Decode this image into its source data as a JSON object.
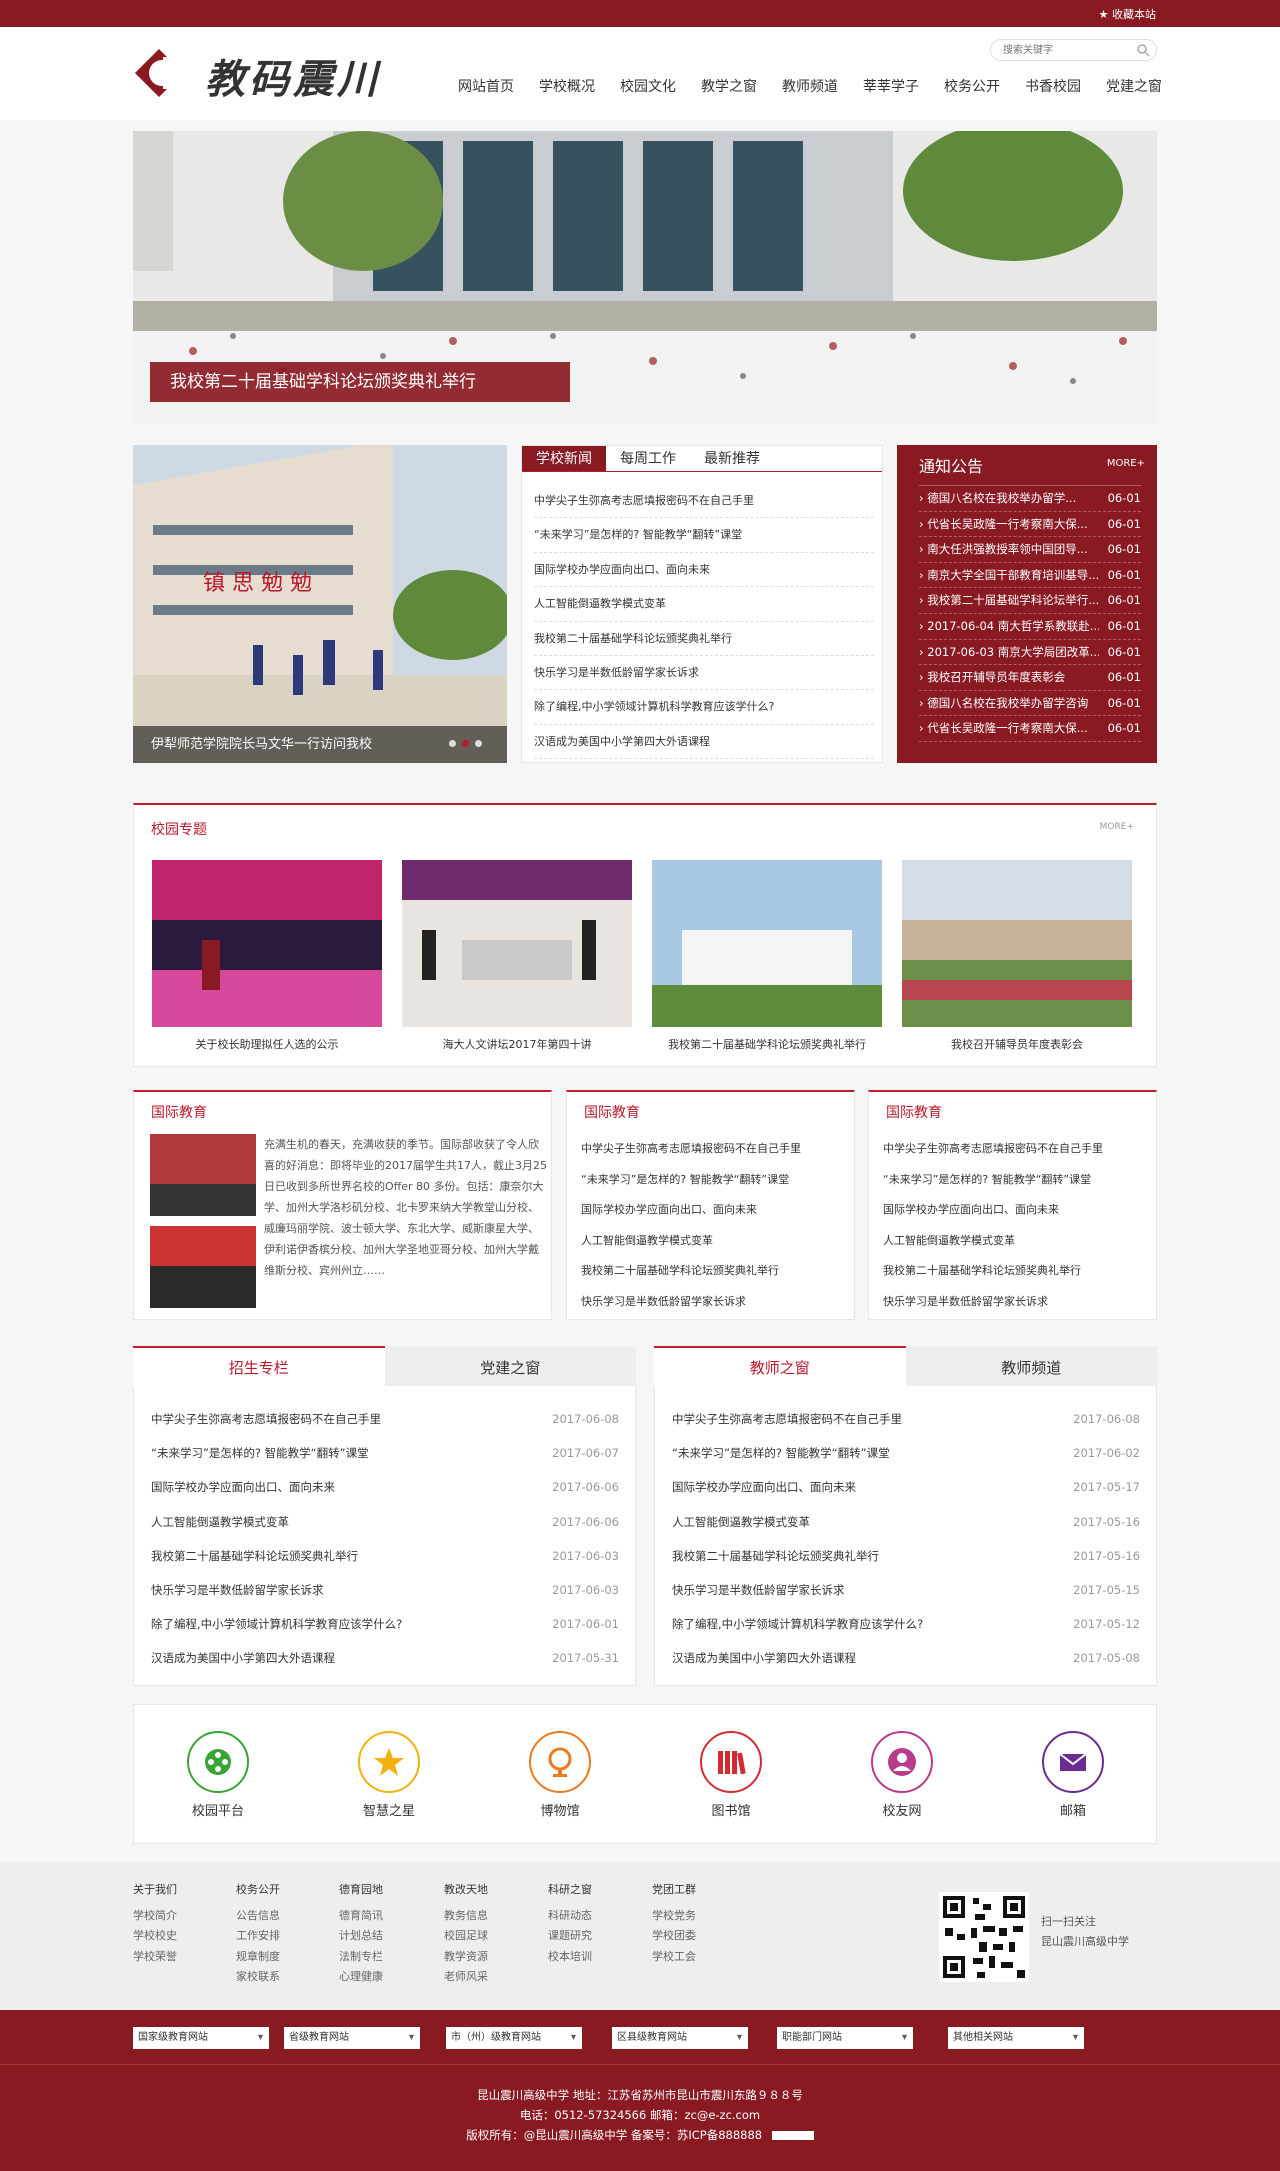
{
  "topbar": {
    "favorite": "收藏本站"
  },
  "header": {
    "logo_text": "教码震川",
    "search_placeholder": "搜索关键字"
  },
  "nav": [
    "网站首页",
    "学校概况",
    "校园文化",
    "教学之窗",
    "教师频道",
    "莘莘学子",
    "校务公开",
    "书香校园",
    "党建之窗"
  ],
  "banner": {
    "caption": "我校第二十届基础学科论坛颁奖典礼举行"
  },
  "slide": {
    "caption": "伊犁师范学院院长马文华一行访问我校"
  },
  "news": {
    "tabs": [
      "学校新闻",
      "每周工作",
      "最新推荐"
    ],
    "items": [
      "中学尖子生弥高考志愿填报密码不在自己手里",
      "“未来学习”是怎样的? 智能教学“翻转”课堂",
      "国际学校办学应面向出口、面向未来",
      "人工智能倒逼教学模式变革",
      "我校第二十届基础学科论坛颁奖典礼举行",
      "快乐学习是半数低龄留学家长诉求",
      "除了编程,中小学领域计算机科学教育应该学什么?",
      "汉语成为美国中小学第四大外语课程"
    ]
  },
  "notice": {
    "title": "通知公告",
    "more": "MORE+",
    "items": [
      {
        "t": "德国八名校在我校举办留学...",
        "d": "06-01"
      },
      {
        "t": "代省长吴政隆一行考察南大保...",
        "d": "06-01"
      },
      {
        "t": "南大任洪强教授率领中国团导...",
        "d": "06-01"
      },
      {
        "t": "南京大学全国干部教育培训基导...",
        "d": "06-01"
      },
      {
        "t": "我校第二十届基础学科论坛举行...",
        "d": "06-01"
      },
      {
        "t": "2017-06-04 南大哲学系教联赴...",
        "d": "06-01"
      },
      {
        "t": "2017-06-03 南京大学局团改革...",
        "d": "06-01"
      },
      {
        "t": "我校召开辅导员年度表彰会",
        "d": "06-01"
      },
      {
        "t": "德国八名校在我校举办留学咨询",
        "d": "06-01"
      },
      {
        "t": "代省长吴政隆一行考察南大保...",
        "d": "06-01"
      }
    ]
  },
  "topics": {
    "title": "校园专题",
    "more": "MORE+",
    "items": [
      "关于校长助理拟任人选的公示",
      "海大人文讲坛2017年第四十讲",
      "我校第二十届基础学科论坛颁奖典礼举行",
      "我校召开辅导员年度表彰会"
    ]
  },
  "intl1": {
    "title": "国际教育",
    "text": "充满生机的春天，充满收获的季节。国际部收获了令人欣喜的好消息：即将毕业的2017届学生共17人，截止3月25日已收到多所世界名校的Offer 80 多份。包括：康奈尔大学、加州大学洛杉矶分校、北卡罗来纳大学教堂山分校、威廉玛丽学院、波士顿大学、东北大学、威斯康星大学、伊利诺伊香槟分校、加州大学圣地亚哥分校、加州大学戴维斯分校、宾州州立……"
  },
  "intl2": {
    "title": "国际教育",
    "items": [
      "中学尖子生弥高考志愿填报密码不在自己手里",
      "“未来学习”是怎样的? 智能教学“翻转”课堂",
      "国际学校办学应面向出口、面向未来",
      "人工智能倒逼教学模式变革",
      "我校第二十届基础学科论坛颁奖典礼举行",
      "快乐学习是半数低龄留学家长诉求"
    ]
  },
  "intl3": {
    "title": "国际教育",
    "items": [
      "中学尖子生弥高考志愿填报密码不在自己手里",
      "“未来学习”是怎样的? 智能教学“翻转”课堂",
      "国际学校办学应面向出口、面向未来",
      "人工智能倒逼教学模式变革",
      "我校第二十届基础学科论坛颁奖典礼举行",
      "快乐学习是半数低龄留学家长诉求"
    ]
  },
  "tab_left": {
    "tabs": [
      "招生专栏",
      "党建之窗"
    ],
    "items": [
      {
        "t": "中学尖子生弥高考志愿填报密码不在自己手里",
        "d": "2017-06-08"
      },
      {
        "t": "“未来学习”是怎样的? 智能教学“翻转”课堂",
        "d": "2017-06-07"
      },
      {
        "t": "国际学校办学应面向出口、面向未来",
        "d": "2017-06-06"
      },
      {
        "t": "人工智能倒逼教学模式变革",
        "d": "2017-06-06"
      },
      {
        "t": "我校第二十届基础学科论坛颁奖典礼举行",
        "d": "2017-06-03"
      },
      {
        "t": "快乐学习是半数低龄留学家长诉求",
        "d": "2017-06-03"
      },
      {
        "t": "除了编程,中小学领域计算机科学教育应该学什么?",
        "d": "2017-06-01"
      },
      {
        "t": "汉语成为美国中小学第四大外语课程",
        "d": "2017-05-31"
      }
    ]
  },
  "tab_right": {
    "tabs": [
      "教师之窗",
      "教师频道"
    ],
    "items": [
      {
        "t": "中学尖子生弥高考志愿填报密码不在自己手里",
        "d": "2017-06-08"
      },
      {
        "t": "“未来学习”是怎样的? 智能教学“翻转”课堂",
        "d": "2017-06-02"
      },
      {
        "t": "国际学校办学应面向出口、面向未来",
        "d": "2017-05-17"
      },
      {
        "t": "人工智能倒逼教学模式变革",
        "d": "2017-05-16"
      },
      {
        "t": "我校第二十届基础学科论坛颁奖典礼举行",
        "d": "2017-05-16"
      },
      {
        "t": "快乐学习是半数低龄留学家长诉求",
        "d": "2017-05-15"
      },
      {
        "t": "除了编程,中小学领域计算机科学教育应该学什么?",
        "d": "2017-05-12"
      },
      {
        "t": "汉语成为美国中小学第四大外语课程",
        "d": "2017-05-08"
      }
    ]
  },
  "quick": [
    {
      "label": "校园平台",
      "color": "#3aa335",
      "icon": "film-icon"
    },
    {
      "label": "智慧之星",
      "color": "#f2b10c",
      "icon": "star-icon"
    },
    {
      "label": "博物馆",
      "color": "#ee7a1d",
      "icon": "globe-icon"
    },
    {
      "label": "图书馆",
      "color": "#d42b33",
      "icon": "books-icon"
    },
    {
      "label": "校友网",
      "color": "#b83b8e",
      "icon": "user-icon"
    },
    {
      "label": "邮箱",
      "color": "#6b2c91",
      "icon": "mail-icon"
    }
  ],
  "footer": {
    "cols": [
      {
        "h": "关于我们",
        "items": [
          "学校简介",
          "学校校史",
          "学校荣誉"
        ]
      },
      {
        "h": "校务公开",
        "items": [
          "公告信息",
          "工作安排",
          "规章制度",
          "家校联系"
        ]
      },
      {
        "h": "德育园地",
        "items": [
          "德育简讯",
          "计划总结",
          "法制专栏",
          "心理健康"
        ]
      },
      {
        "h": "教改天地",
        "items": [
          "教务信息",
          "校园足球",
          "教学资源",
          "老师风采"
        ]
      },
      {
        "h": "科研之窗",
        "items": [
          "科研动态",
          "课题研究",
          "校本培训"
        ]
      },
      {
        "h": "党团工群",
        "items": [
          "学校党务",
          "学校团委",
          "学校工会"
        ]
      }
    ],
    "qr_text": [
      "扫一扫关注",
      "昆山震川高级中学"
    ]
  },
  "links": [
    "国家级教育网站",
    "省级教育网站",
    "市（州）级教育网站",
    "区县级教育网站",
    "职能部门网站",
    "其他相关网站"
  ],
  "copy": [
    "昆山震川高级中学  地址：江苏省苏州市昆山市震川东路９８８号",
    "电话：0512-57324566   邮箱：zc@e-zc.com",
    "版权所有：@昆山震川高级中学   备案号：苏ICP备888888"
  ]
}
